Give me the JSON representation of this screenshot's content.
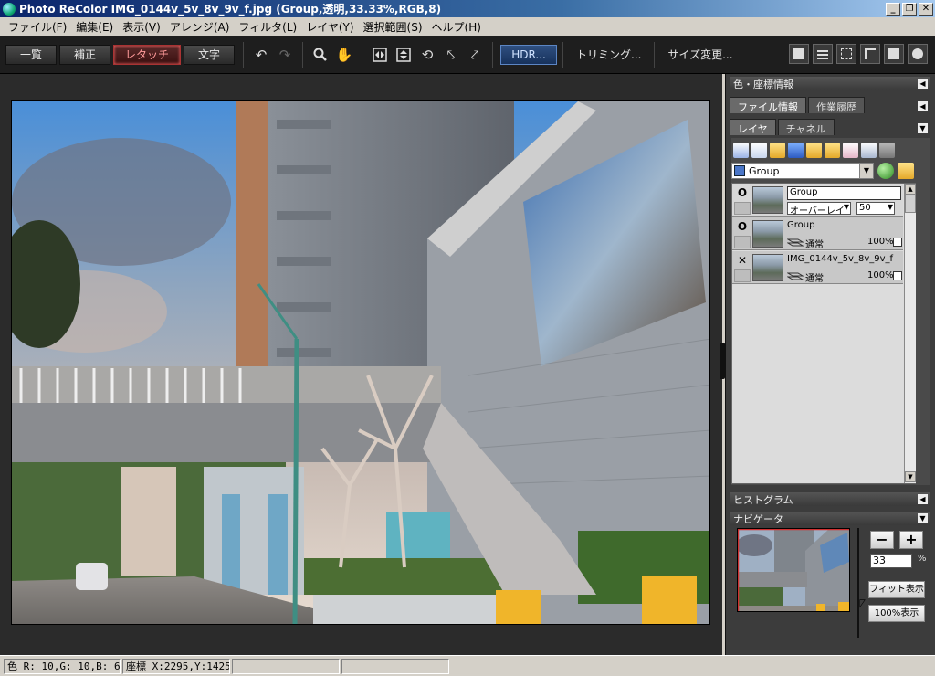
{
  "window": {
    "title": "Photo ReColor IMG_0144v_5v_8v_9v_f.jpg (Group,透明,33.33%,RGB,8)",
    "controls": [
      "_",
      "❐",
      "✕"
    ]
  },
  "menu": [
    "ファイル(F)",
    "編集(E)",
    "表示(V)",
    "アレンジ(A)",
    "フィルタ(L)",
    "レイヤ(Y)",
    "選択範囲(S)",
    "ヘルプ(H)"
  ],
  "toolbar": {
    "tabs": [
      "一覧",
      "補正",
      "レタッチ",
      "文字"
    ],
    "active_tab": "レタッチ",
    "hdr_label": "HDR...",
    "trimming_label": "トリミング...",
    "resize_label": "サイズ変更..."
  },
  "panels": {
    "color_coords": "色・座標情報",
    "file_info_tab": "ファイル情報",
    "history_tab": "作業履歴",
    "layer_tab": "レイヤ",
    "channel_tab": "チャネル",
    "histogram": "ヒストグラム",
    "navigator": "ナビゲータ"
  },
  "layers": {
    "current_group": "Group",
    "rows": [
      {
        "name": "Group",
        "mode": "オーバーレイ",
        "opacity": "50",
        "visible": "O"
      },
      {
        "name": "Group",
        "mode": "通常",
        "opacity": "100%",
        "visible": "O"
      },
      {
        "name": "IMG_0144v_5v_8v_9v_f",
        "mode": "通常",
        "opacity": "100%",
        "visible": "✕"
      }
    ]
  },
  "navigator": {
    "zoom": "33",
    "pct": "%",
    "minus": "−",
    "plus": "+",
    "fit_label": "フィット表示",
    "full_label": "100%表示"
  },
  "status": {
    "color": "色 R: 10,G: 10,B:  6",
    "coords": "座標 X:2295,Y:1425"
  },
  "colors": {
    "accent": "#a33333",
    "hdr": "#2f4f80",
    "dark_bg": "#2b2b2b"
  }
}
